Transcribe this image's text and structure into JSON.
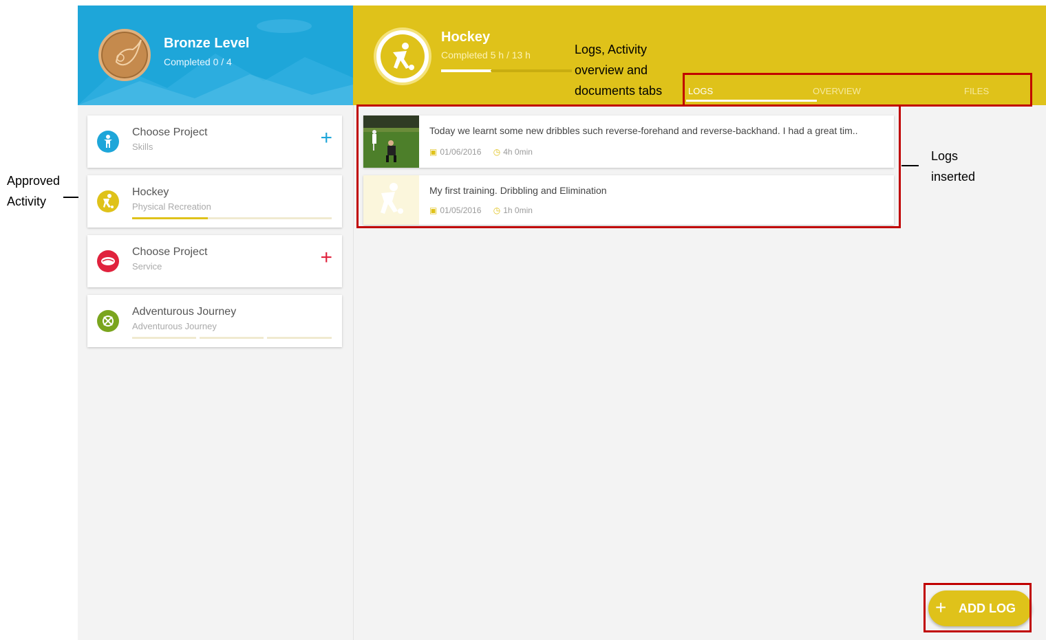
{
  "level": {
    "title": "Bronze Level",
    "progress": "Completed 0 / 4"
  },
  "cards": [
    {
      "title": "Choose Project",
      "subtitle": "Skills",
      "color": "#1ea6d9",
      "icon": "skills-icon",
      "action": "+"
    },
    {
      "title": "Hockey",
      "subtitle": "Physical Recreation",
      "color": "#dfc21a",
      "icon": "hockey-player-icon",
      "progress": 0.38
    },
    {
      "title": "Choose Project",
      "subtitle": "Service",
      "color": "#e0223d",
      "icon": "handshake-icon",
      "action": "+"
    },
    {
      "title": "Adventurous Journey",
      "subtitle": "Adventurous Journey",
      "color": "#7aa51e",
      "icon": "compass-icon"
    }
  ],
  "activity": {
    "title": "Hockey",
    "progress": "Completed 5 h / 13 h",
    "fraction": 0.385
  },
  "tabs": [
    "LOGS",
    "OVERVIEW",
    "FILES"
  ],
  "logs": [
    {
      "text": "Today we learnt some new dribbles such reverse-forehand and reverse-backhand. I had a great tim..",
      "date": "01/06/2016",
      "duration": "4h 0min"
    },
    {
      "text": "My first training. Dribbling and Elimination",
      "date": "01/05/2016",
      "duration": "1h 0min"
    }
  ],
  "fab": {
    "plus": "+",
    "label": "ADD LOG"
  },
  "annotations": {
    "approved_line1": "Approved",
    "approved_line2": "Activity",
    "tabs_line1": "Logs, Activity",
    "tabs_line2": "overview and",
    "tabs_line3": "documents tabs",
    "logs_line1": "Logs",
    "logs_line2": "inserted"
  },
  "colors": {
    "annotation_box": "#c00000",
    "accent_yellow": "#dfc21a",
    "accent_blue": "#1ea6d9"
  }
}
